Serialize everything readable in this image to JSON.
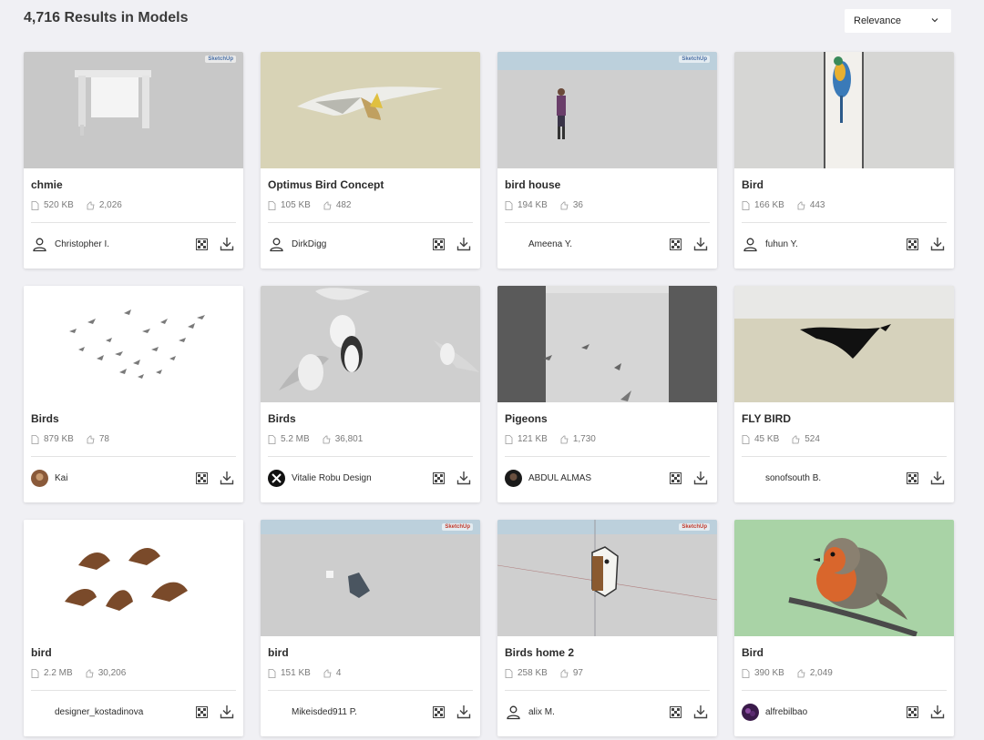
{
  "header": {
    "results_title": "4,716 Results in Models",
    "sort_value": "Relevance"
  },
  "badges": {
    "sketchup": "SketchUp"
  },
  "cards": [
    {
      "title": "chmie",
      "size": "520 KB",
      "likes": "2,026",
      "author": "Christopher I."
    },
    {
      "title": "Optimus Bird Concept",
      "size": "105 KB",
      "likes": "482",
      "author": "DirkDigg"
    },
    {
      "title": "bird house",
      "size": "194 KB",
      "likes": "36",
      "author": "Ameena Y."
    },
    {
      "title": "Bird",
      "size": "166 KB",
      "likes": "443",
      "author": "fuhun Y."
    },
    {
      "title": "Birds",
      "size": "879 KB",
      "likes": "78",
      "author": "Kai"
    },
    {
      "title": "Birds",
      "size": "5.2 MB",
      "likes": "36,801",
      "author": "Vitalie Robu Design"
    },
    {
      "title": "Pigeons",
      "size": "121 KB",
      "likes": "1,730",
      "author": "ABDUL ALMAS"
    },
    {
      "title": "FLY BIRD",
      "size": "45 KB",
      "likes": "524",
      "author": "sonofsouth B."
    },
    {
      "title": "bird",
      "size": "2.2 MB",
      "likes": "30,206",
      "author": "designer_kostadinova"
    },
    {
      "title": "bird",
      "size": "151 KB",
      "likes": "4",
      "author": "Mikeisded911 P."
    },
    {
      "title": "Birds home 2",
      "size": "258 KB",
      "likes": "97",
      "author": "alix M."
    },
    {
      "title": "Bird",
      "size": "390 KB",
      "likes": "2,049",
      "author": "alfrebilbao"
    }
  ]
}
